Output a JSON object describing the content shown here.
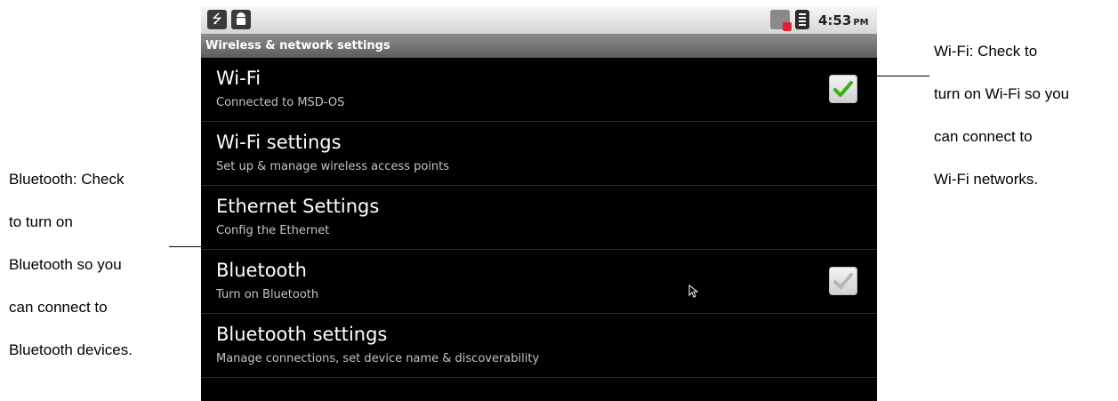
{
  "statusbar": {
    "icons": [
      "usb-icon",
      "android-icon",
      "ethernet-off-icon",
      "wifi-signal-icon"
    ],
    "time": "4:53",
    "ampm": "PM"
  },
  "titlebar": {
    "title": "Wireless & network settings"
  },
  "settings": [
    {
      "title": "Wi-Fi",
      "summary": "Connected to MSD-OS",
      "checkbox": true,
      "checked": true
    },
    {
      "title": "Wi-Fi settings",
      "summary": "Set up & manage wireless access points",
      "checkbox": false
    },
    {
      "title": "Ethernet Settings",
      "summary": "Config the Ethernet",
      "checkbox": false
    },
    {
      "title": "Bluetooth",
      "summary": "Turn on Bluetooth",
      "checkbox": true,
      "checked": false
    },
    {
      "title": "Bluetooth settings",
      "summary": "Manage connections, set device name & discoverability",
      "checkbox": false
    }
  ],
  "annotations": {
    "right": [
      "Wi-Fi:    Check to",
      "turn on Wi-Fi so you",
      "can connect to",
      "Wi-Fi networks."
    ],
    "left": [
      "Bluetooth: Check",
      "to turn on",
      "Bluetooth so you",
      "can connect to",
      "Bluetooth devices."
    ]
  },
  "colors": {
    "check_green": "#3cb017",
    "check_disabled": "#b5b5b5",
    "screen_bg": "#000000"
  }
}
